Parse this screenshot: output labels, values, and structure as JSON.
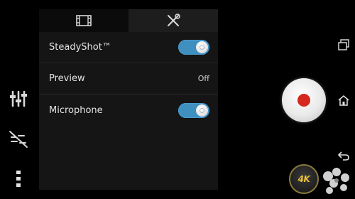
{
  "tabs": [
    {
      "icon": "video-camera-icon",
      "active": true
    },
    {
      "icon": "tools-icon",
      "active": false
    }
  ],
  "settings": {
    "steadyshot": {
      "label": "SteadyShot™",
      "on": true
    },
    "preview": {
      "label": "Preview",
      "value": "Off"
    },
    "microphone": {
      "label": "Microphone",
      "on": true
    }
  },
  "badge": {
    "label": "4K"
  },
  "colors": {
    "toggle_on": "#3f8fbf",
    "record_red": "#d5281e",
    "badge_gold": "#e9c23a"
  }
}
